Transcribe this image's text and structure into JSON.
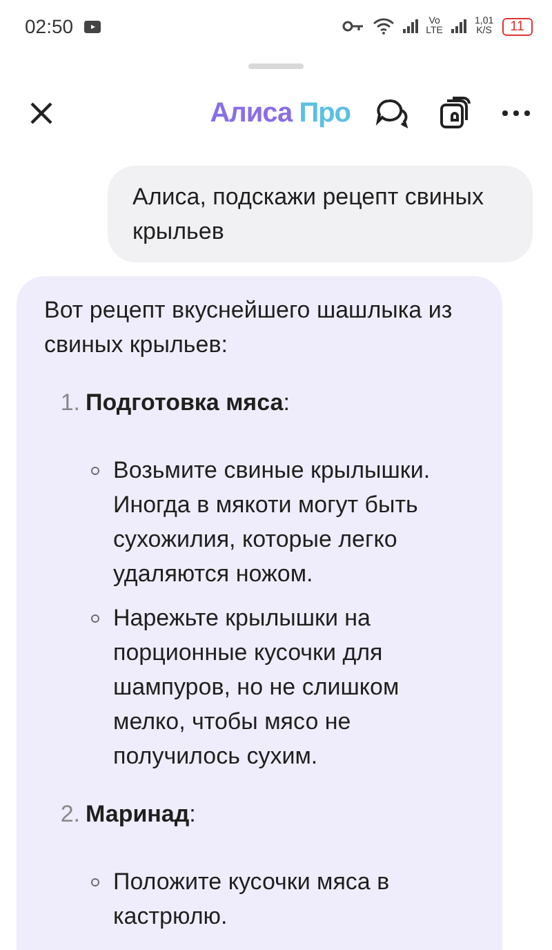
{
  "status_bar": {
    "time": "02:50",
    "volte_top": "Vo",
    "volte_bottom": "LTE",
    "speed_value": "1,01",
    "speed_unit": "K/S",
    "battery": "11"
  },
  "header": {
    "title": "Алиса",
    "title_suffix": "Про"
  },
  "messages": [
    {
      "kind": "user",
      "text": "Алиса, подскажи рецепт свиных крыльев"
    },
    {
      "kind": "assistant",
      "intro": "Вот рецепт вкуснейшего шашлыка из свиных крыльев:",
      "steps": [
        {
          "number": "1.",
          "title": "**Подготовка мяса**:",
          "bullets": [
            "Возьмите свиные крылышки. Иногда в мякоти могут быть сухожилия, которые легко удаляются ножом.",
            "Нарежьте крылышки на порционные кусочки для шампуров, но не слишком мелко, чтобы мясо не получилось сухим."
          ]
        },
        {
          "number": "2.",
          "title": "**Маринад**:",
          "bullets": [
            "Положите кусочки мяса в кастрюлю."
          ]
        }
      ]
    }
  ]
}
